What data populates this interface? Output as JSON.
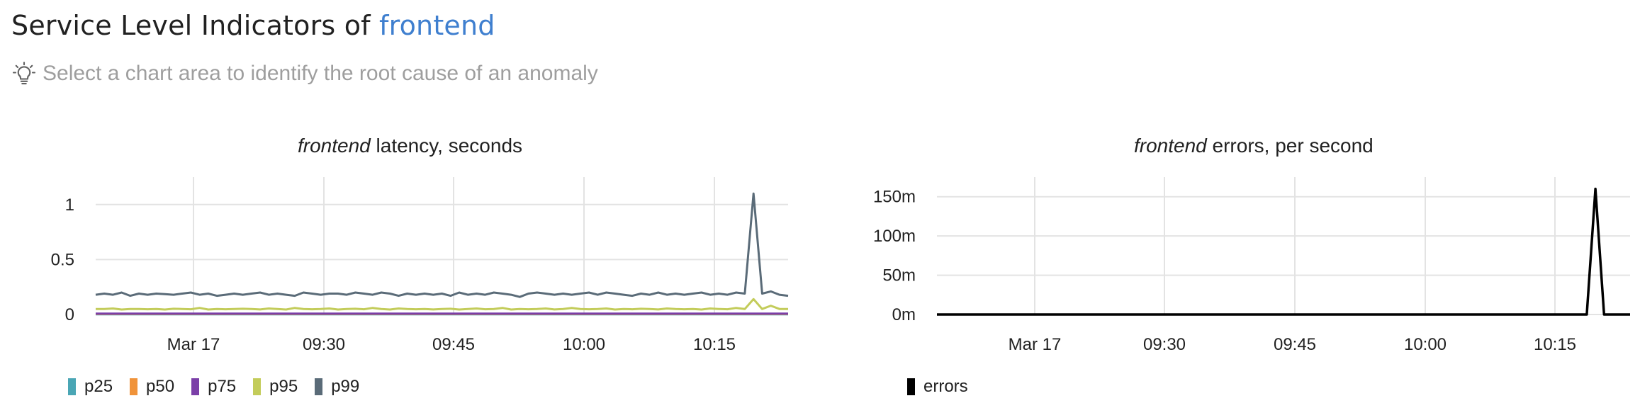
{
  "header": {
    "title_prefix": "Service Level Indicators of",
    "service": "frontend",
    "hint": "Select a chart area to identify the root cause of an anomaly",
    "hint_icon": "lightbulb-icon"
  },
  "colors": {
    "p25": "#4aa6b5",
    "p50": "#f0933a",
    "p75": "#7b3fa8",
    "p95": "#c3cc5a",
    "p99": "#5a6b78",
    "errors": "#000000",
    "service_link": "#3f7fcf"
  },
  "chart_data": [
    {
      "type": "line",
      "title_service": "frontend",
      "title_rest": "latency, seconds",
      "x_ticks": [
        "Mar 17",
        "09:30",
        "09:45",
        "10:00",
        "10:15"
      ],
      "y_ticks": [
        "0",
        "0.5",
        "1"
      ],
      "ylim": [
        0,
        1.25
      ],
      "grid": true,
      "legend": "bottom-left",
      "x_start": "09:07",
      "x_end": "10:27",
      "series": [
        {
          "name": "p25",
          "color": "#4aa6b5",
          "values": [
            0.002,
            0.002,
            0.002,
            0.002,
            0.002,
            0.002,
            0.002,
            0.002,
            0.002,
            0.002,
            0.002,
            0.002,
            0.002,
            0.002,
            0.002,
            0.002,
            0.002,
            0.002,
            0.002,
            0.002,
            0.002,
            0.002,
            0.002,
            0.002,
            0.002,
            0.002,
            0.002,
            0.002,
            0.002,
            0.002,
            0.002,
            0.002,
            0.002,
            0.002,
            0.002,
            0.002,
            0.002,
            0.002,
            0.002,
            0.002,
            0.002,
            0.002,
            0.002,
            0.002,
            0.002,
            0.002,
            0.002,
            0.002,
            0.002,
            0.002,
            0.002,
            0.002,
            0.002,
            0.002,
            0.002,
            0.002,
            0.002,
            0.002,
            0.002,
            0.002,
            0.002,
            0.002,
            0.002,
            0.002,
            0.002,
            0.002,
            0.002,
            0.002,
            0.002,
            0.002,
            0.002,
            0.002,
            0.002,
            0.002,
            0.002,
            0.002,
            0.002,
            0.002,
            0.002,
            0.002,
            0.002
          ]
        },
        {
          "name": "p50",
          "color": "#f0933a",
          "values": [
            0.005,
            0.005,
            0.005,
            0.005,
            0.005,
            0.005,
            0.005,
            0.005,
            0.005,
            0.005,
            0.005,
            0.005,
            0.005,
            0.005,
            0.005,
            0.005,
            0.005,
            0.005,
            0.005,
            0.005,
            0.005,
            0.005,
            0.005,
            0.005,
            0.005,
            0.005,
            0.005,
            0.005,
            0.005,
            0.005,
            0.005,
            0.005,
            0.005,
            0.005,
            0.005,
            0.005,
            0.005,
            0.005,
            0.005,
            0.005,
            0.005,
            0.005,
            0.005,
            0.005,
            0.005,
            0.005,
            0.005,
            0.005,
            0.005,
            0.005,
            0.005,
            0.005,
            0.005,
            0.005,
            0.005,
            0.005,
            0.005,
            0.005,
            0.005,
            0.005,
            0.005,
            0.005,
            0.005,
            0.005,
            0.005,
            0.005,
            0.005,
            0.005,
            0.005,
            0.005,
            0.005,
            0.005,
            0.005,
            0.005,
            0.005,
            0.005,
            0.005,
            0.005,
            0.005,
            0.005,
            0.005
          ]
        },
        {
          "name": "p75",
          "color": "#7b3fa8",
          "values": [
            0.008,
            0.008,
            0.008,
            0.008,
            0.008,
            0.008,
            0.008,
            0.008,
            0.008,
            0.008,
            0.008,
            0.008,
            0.008,
            0.008,
            0.008,
            0.008,
            0.008,
            0.008,
            0.008,
            0.008,
            0.008,
            0.008,
            0.008,
            0.008,
            0.008,
            0.008,
            0.008,
            0.008,
            0.008,
            0.008,
            0.008,
            0.008,
            0.008,
            0.008,
            0.008,
            0.008,
            0.008,
            0.008,
            0.008,
            0.008,
            0.008,
            0.008,
            0.008,
            0.008,
            0.008,
            0.008,
            0.008,
            0.008,
            0.008,
            0.008,
            0.008,
            0.008,
            0.008,
            0.008,
            0.008,
            0.008,
            0.008,
            0.008,
            0.008,
            0.008,
            0.008,
            0.008,
            0.008,
            0.008,
            0.008,
            0.008,
            0.008,
            0.008,
            0.008,
            0.008,
            0.008,
            0.008,
            0.008,
            0.008,
            0.008,
            0.008,
            0.008,
            0.008,
            0.008,
            0.008,
            0.008
          ]
        },
        {
          "name": "p95",
          "color": "#c3cc5a",
          "values": [
            0.05,
            0.05,
            0.055,
            0.045,
            0.05,
            0.05,
            0.048,
            0.05,
            0.045,
            0.052,
            0.05,
            0.048,
            0.06,
            0.045,
            0.05,
            0.048,
            0.05,
            0.052,
            0.05,
            0.046,
            0.055,
            0.05,
            0.045,
            0.06,
            0.05,
            0.048,
            0.05,
            0.055,
            0.045,
            0.05,
            0.052,
            0.048,
            0.06,
            0.05,
            0.045,
            0.055,
            0.05,
            0.048,
            0.05,
            0.046,
            0.05,
            0.052,
            0.045,
            0.05,
            0.055,
            0.048,
            0.05,
            0.06,
            0.045,
            0.05,
            0.048,
            0.05,
            0.055,
            0.046,
            0.05,
            0.06,
            0.05,
            0.048,
            0.05,
            0.055,
            0.045,
            0.05,
            0.048,
            0.052,
            0.05,
            0.046,
            0.055,
            0.05,
            0.048,
            0.05,
            0.045,
            0.055,
            0.05,
            0.048,
            0.06,
            0.05,
            0.14,
            0.05,
            0.08,
            0.05,
            0.05
          ]
        },
        {
          "name": "p99",
          "color": "#5a6b78",
          "values": [
            0.18,
            0.19,
            0.18,
            0.2,
            0.17,
            0.19,
            0.18,
            0.19,
            0.185,
            0.18,
            0.19,
            0.2,
            0.18,
            0.19,
            0.17,
            0.18,
            0.19,
            0.18,
            0.19,
            0.2,
            0.18,
            0.19,
            0.18,
            0.17,
            0.2,
            0.19,
            0.18,
            0.19,
            0.19,
            0.18,
            0.2,
            0.19,
            0.18,
            0.2,
            0.19,
            0.17,
            0.19,
            0.18,
            0.19,
            0.18,
            0.19,
            0.17,
            0.2,
            0.18,
            0.19,
            0.18,
            0.2,
            0.19,
            0.18,
            0.16,
            0.19,
            0.2,
            0.19,
            0.18,
            0.19,
            0.18,
            0.19,
            0.2,
            0.18,
            0.2,
            0.19,
            0.18,
            0.17,
            0.19,
            0.18,
            0.2,
            0.18,
            0.19,
            0.18,
            0.19,
            0.2,
            0.18,
            0.19,
            0.18,
            0.2,
            0.19,
            1.1,
            0.19,
            0.21,
            0.18,
            0.17
          ]
        }
      ]
    },
    {
      "type": "line",
      "title_service": "frontend",
      "title_rest": "errors, per second",
      "x_ticks": [
        "Mar 17",
        "09:30",
        "09:45",
        "10:00",
        "10:15"
      ],
      "y_ticks": [
        "0m",
        "50m",
        "100m",
        "150m"
      ],
      "ylim": [
        0,
        0.175
      ],
      "grid": true,
      "legend": "bottom-left",
      "x_start": "09:07",
      "x_end": "10:27",
      "series": [
        {
          "name": "errors",
          "color": "#000000",
          "values": [
            0,
            0,
            0,
            0,
            0,
            0,
            0,
            0,
            0,
            0,
            0,
            0,
            0,
            0,
            0,
            0,
            0,
            0,
            0,
            0,
            0,
            0,
            0,
            0,
            0,
            0,
            0,
            0,
            0,
            0,
            0,
            0,
            0,
            0,
            0,
            0,
            0,
            0,
            0,
            0,
            0,
            0,
            0,
            0,
            0,
            0,
            0,
            0,
            0,
            0,
            0,
            0,
            0,
            0,
            0,
            0,
            0,
            0,
            0,
            0,
            0,
            0,
            0,
            0,
            0,
            0,
            0,
            0,
            0,
            0,
            0,
            0,
            0,
            0,
            0,
            0,
            0.16,
            0,
            0,
            0,
            0
          ]
        }
      ]
    }
  ]
}
